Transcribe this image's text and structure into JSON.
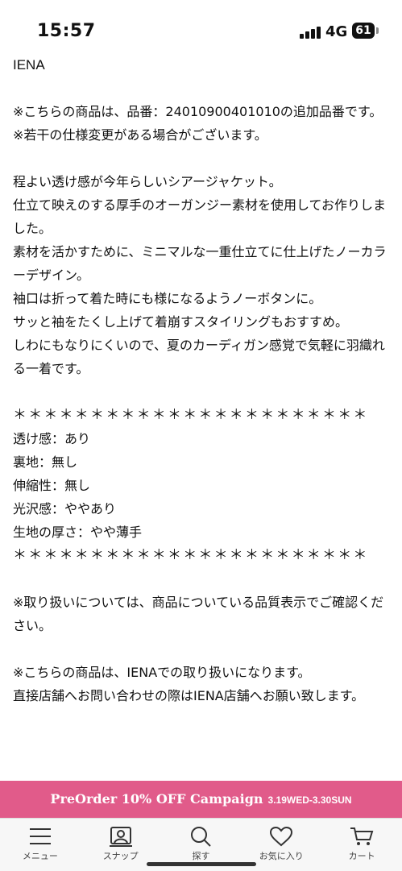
{
  "status_bar": {
    "time": "15:57",
    "network": "4G",
    "battery": "61"
  },
  "description": {
    "brand": "IENA",
    "note_lines": [
      "※こちらの商品は、品番：24010900401010の追加品番です。",
      "※若干の仕様変更がある場合がございます。"
    ],
    "body_lines": [
      "程よい透け感が今年らしいシアージャケット。",
      "仕立て映えのする厚手のオーガンジー素材を使用してお作りしました。",
      "素材を活かすために、ミニマルな一重仕立てに仕上げたノーカラーデザイン。",
      "袖口は折って着た時にも様になるようノーボタンに。",
      "サッと袖をたくし上げて着崩すスタイリングもおすすめ。",
      "しわにもなりにくいので、夏のカーディガン感覚で気軽に羽織れる一着です。"
    ],
    "stars": "＊＊＊＊＊＊＊＊＊＊＊＊＊＊＊＊＊＊＊＊＊＊＊",
    "specs": [
      "透け感：あり",
      "裏地：無し",
      "伸縮性：無し",
      "光沢感：ややあり",
      "生地の厚さ：やや薄手"
    ],
    "handling_note": "※取り扱いについては、商品についている品質表示でご確認ください。",
    "store_note_lines": [
      "※こちらの商品は、IENAでの取り扱いになります。",
      "直接店舗へお問い合わせの際はIENA店舗へお願い致します。"
    ]
  },
  "banner": {
    "text": "PreOrder 10% OFF Campaign",
    "dates": "3.19WED-3.30SUN",
    "color": "#e15b8a"
  },
  "tabbar": {
    "items": [
      {
        "label": "メニュー",
        "icon": "menu-icon"
      },
      {
        "label": "スナップ",
        "icon": "snap-icon"
      },
      {
        "label": "探す",
        "icon": "search-icon"
      },
      {
        "label": "お気に入り",
        "icon": "heart-icon"
      },
      {
        "label": "カート",
        "icon": "cart-icon"
      }
    ]
  }
}
